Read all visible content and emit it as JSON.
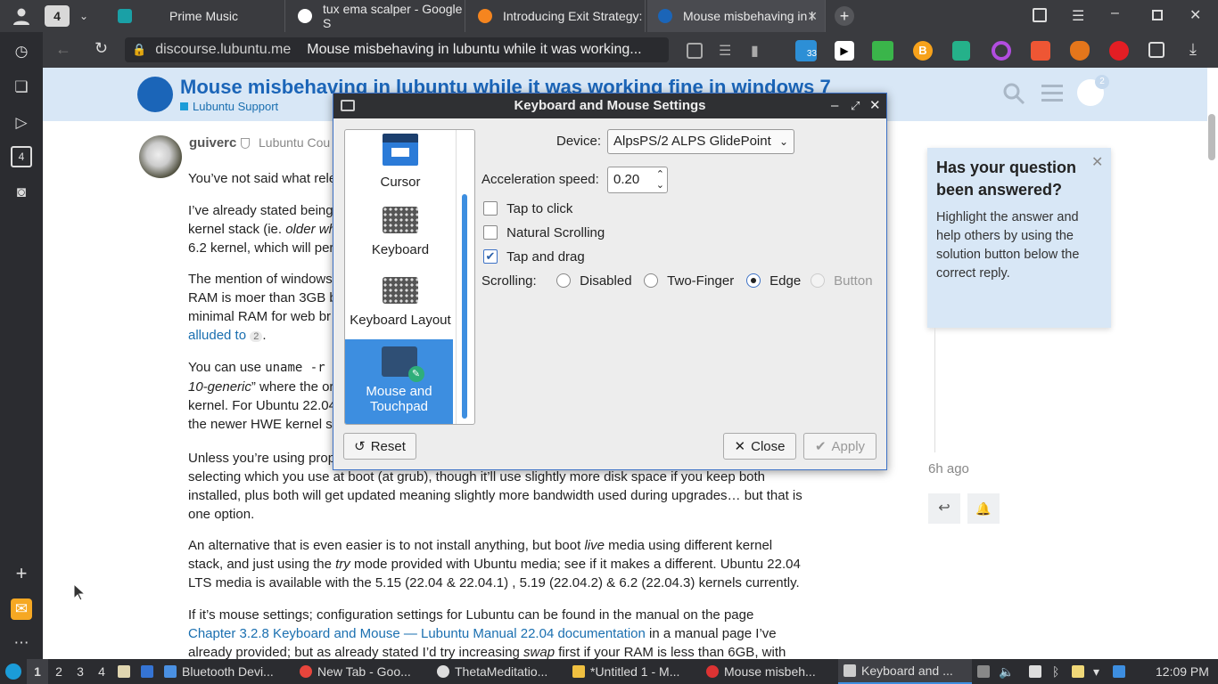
{
  "tabs": [
    {
      "label": "4",
      "kind": "group"
    },
    {
      "label": "Prime Music",
      "color": "#1aa0a6"
    },
    {
      "label": "tux ema scalper - Google S",
      "color": "#ffffff"
    },
    {
      "label": "Introducing Exit Strategy:",
      "color": "#f5851f"
    },
    {
      "label": "Mouse misbehaving in l",
      "color": "#ffffff",
      "active": true
    }
  ],
  "address": {
    "url": "discourse.lubuntu.me",
    "page_title": "Mouse misbehaving in lubuntu while it was working..."
  },
  "extensions": {
    "badge_count": "33"
  },
  "header": {
    "title": "Mouse misbehaving in lubuntu while it was working fine in windows 7",
    "category": "Lubuntu Support",
    "notification_count": "2"
  },
  "post": {
    "author": "guiverc",
    "author_extra": "Lubuntu Cou",
    "p1": "You’ve not said what rele",
    "p2a": "I’ve already stated being",
    "p2b": "kernel stack (ie.",
    "p2b_em": "older wh",
    "p2c": "6.2 kernel, which will per",
    "p3a": "The mention of windows",
    "p3b": "RAM is moer than 3GB b",
    "p3c": "minimal RAM for web br",
    "p3d": "alluded to",
    "p3d_badge": "2",
    "p4a_pre": "You can use",
    "p4a_code": "uname -r",
    "p4b": "10-generic",
    "p4b_post": "” where the or",
    "p4c": "kernel. For Ubuntu 22.04",
    "p4d": "the newer HWE kernel s",
    "p5a": "Unless you’re using prop",
    "p5b": "selecting which you use at boot (at grub), though it’ll use slightly more disk space if you keep both",
    "p5c": "installed, plus both will get updated meaning slightly more bandwidth used during upgrades… but that is",
    "p5d": "one option.",
    "p6a_pre": "An alternative that is even easier is to not install anything, but boot",
    "p6a_em": "live",
    "p6a_post": "media using different kernel",
    "p6b_pre": "stack, and just using the",
    "p6b_em": "try",
    "p6b_post": "mode provided with Ubuntu media; see if it makes a different. Ubuntu 22.04",
    "p6c": "LTS media is available with the 5.15 (22.04 & 22.04.1) , 5.19 (22.04.2) & 6.2 (22.04.3) kernels currently.",
    "p7a": "If it’s mouse settings; configuration settings for Lubuntu can be found in the manual on the page",
    "p7b_link": "Chapter 3.2.8 Keyboard and Mouse — Lubuntu Manual 22.04 documentation",
    "p7b_post": "in a manual page I’ve",
    "p7c_pre": "already provided; but as already stated I’d try increasing",
    "p7c_em": "swap",
    "p7c_post": "first if your RAM is less than 6GB, with"
  },
  "notice": {
    "title": "Has your question been answered?",
    "body": "Highlight the answer and help others by using the solution button below the correct reply."
  },
  "timeline": {
    "ago": "6h ago"
  },
  "dialog": {
    "title": "Keyboard and Mouse Settings",
    "categories": [
      {
        "label": "Cursor",
        "icon": "cursor-icon"
      },
      {
        "label": "Keyboard",
        "icon": "keyboard-icon"
      },
      {
        "label": "Keyboard Layout",
        "icon": "keyboard-layout-icon"
      },
      {
        "label": "Mouse and Touchpad",
        "icon": "mouse-touchpad-icon",
        "selected": true
      }
    ],
    "device_label": "Device:",
    "device_value": "AlpsPS/2 ALPS GlidePoint",
    "accel_label": "Acceleration speed:",
    "accel_value": "0.20",
    "tap_to_click": "Tap to click",
    "tap_to_click_checked": false,
    "natural_scrolling": "Natural Scrolling",
    "natural_scrolling_checked": false,
    "tap_and_drag": "Tap and drag",
    "tap_and_drag_checked": true,
    "scrolling_label": "Scrolling:",
    "scrolling_options": [
      "Disabled",
      "Two-Finger",
      "Edge",
      "Button"
    ],
    "scrolling_selected": "Edge",
    "reset": "Reset",
    "close": "Close",
    "apply": "Apply"
  },
  "taskbar": {
    "workspaces": [
      "1",
      "2",
      "3",
      "4"
    ],
    "items": [
      {
        "label": "Bluetooth Devi...",
        "color": "#4a90e2"
      },
      {
        "label": "New Tab - Goo...",
        "color": "#e8453c"
      },
      {
        "label": "ThetaMeditatio...",
        "color": "#dddddd"
      },
      {
        "label": "*Untitled 1 - M...",
        "color": "#f0c040"
      },
      {
        "label": "Mouse misbeh...",
        "color": "#d33"
      },
      {
        "label": "Keyboard and ...",
        "color": "#cccccc",
        "active": true
      }
    ],
    "clock": "12:09 PM"
  }
}
